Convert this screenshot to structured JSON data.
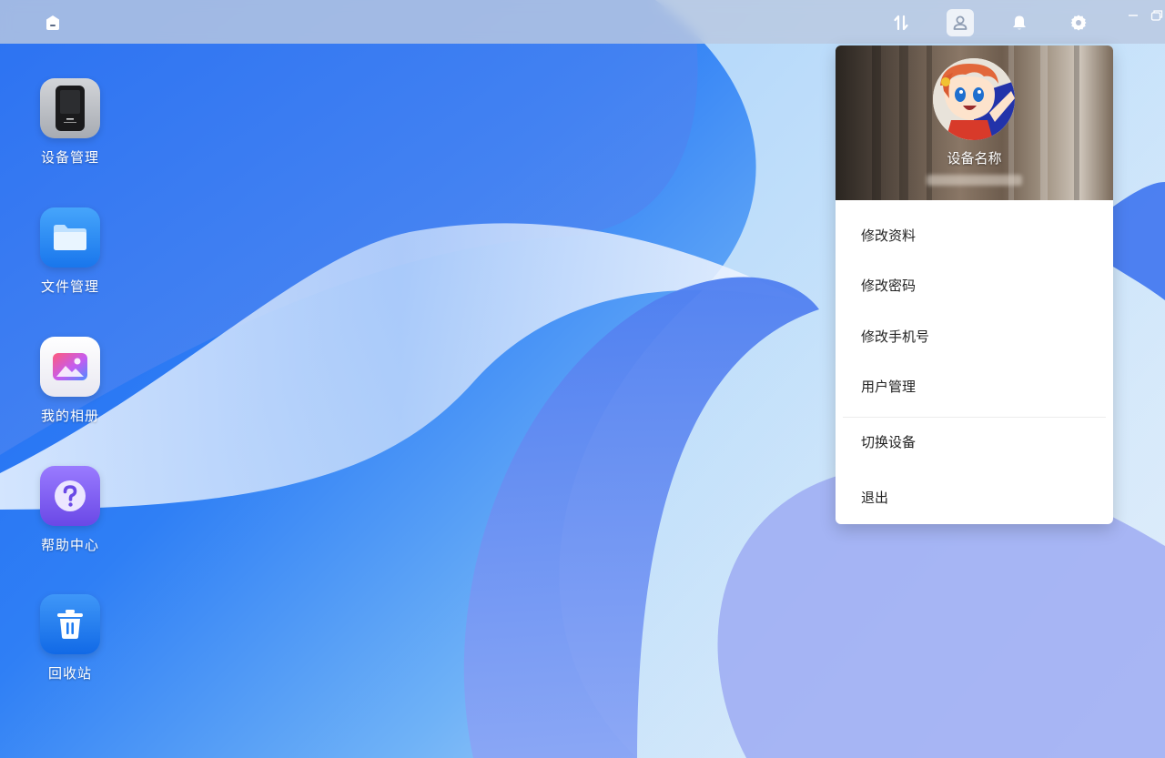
{
  "topbar": {
    "icons": [
      "home-icon",
      "transfer-icon",
      "user-icon",
      "bell-icon",
      "gear-icon",
      "minimize-icon",
      "restore-icon"
    ]
  },
  "desktop": {
    "items": [
      {
        "label": "设备管理",
        "icon": "device-icon",
        "color": "#b9bcc2"
      },
      {
        "label": "文件管理",
        "icon": "folder-icon",
        "color": "#2a86ef"
      },
      {
        "label": "我的相册",
        "icon": "photo-icon",
        "color": "#f2f2f7"
      },
      {
        "label": "帮助中心",
        "icon": "help-icon",
        "color": "#7a5ef0"
      },
      {
        "label": "回收站",
        "icon": "trash-icon",
        "color": "#1d7cf0"
      }
    ]
  },
  "user_menu": {
    "device_name": "设备名称",
    "items": [
      {
        "label": "修改资料"
      },
      {
        "label": "修改密码"
      },
      {
        "label": "修改手机号"
      },
      {
        "label": "用户管理"
      },
      {
        "label": "切换设备"
      },
      {
        "label": "退出"
      }
    ]
  },
  "colors": {
    "accent": "#1f6ff0",
    "menu_bg": "#ffffff",
    "menu_text": "#222222"
  }
}
